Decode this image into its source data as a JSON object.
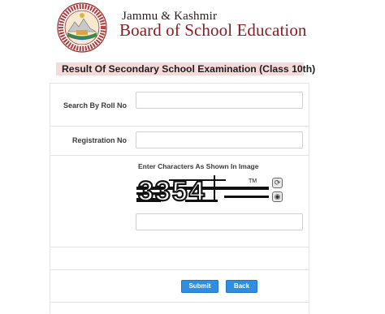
{
  "header": {
    "org_line1": "Jammu & Kashmir",
    "org_line2": "Board of School Education"
  },
  "page_title": "Result Of Secondary School Examination (Class 10th)",
  "form": {
    "roll_label": "Search By Roll No",
    "roll_value": "",
    "registration_label": "Registration No",
    "registration_value": "",
    "captcha_label": "Enter Characters As Shown In Image",
    "captcha_text": "3354",
    "captcha_value": ""
  },
  "buttons": {
    "submit": "Submit",
    "back": "Back"
  },
  "colors": {
    "brand_maroon": "#8b1c22",
    "title_band": "#f6d9d9",
    "button_blue": "#2f8ee0"
  },
  "icons": {
    "refresh": "refresh-icon",
    "audio": "audio-icon",
    "logo": "jkbose-logo-emblem"
  }
}
